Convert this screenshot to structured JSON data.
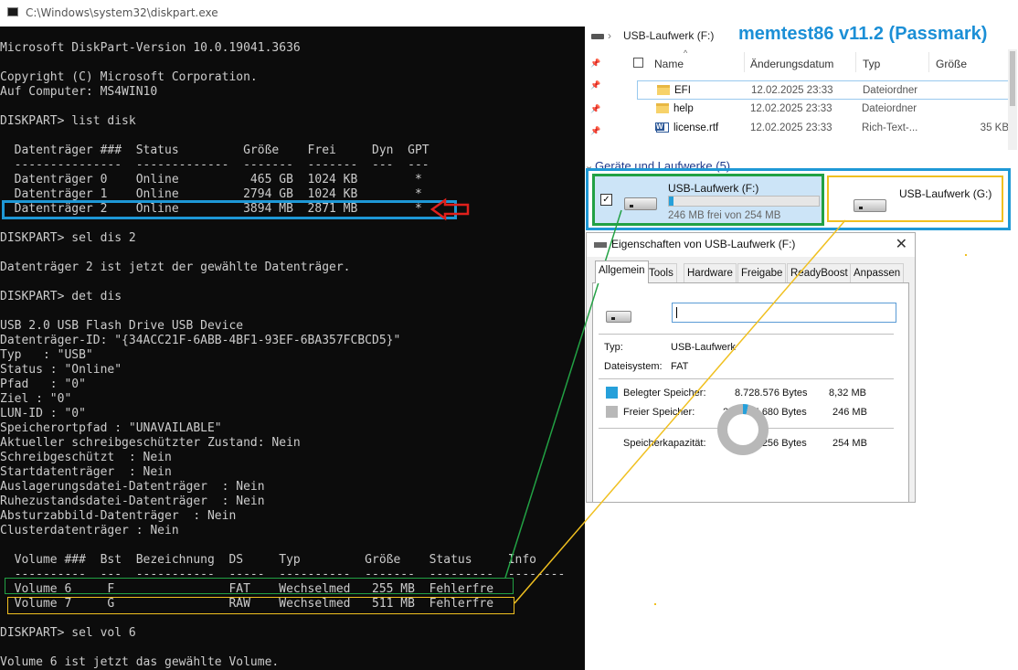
{
  "cmd": {
    "title": "C:\\Windows\\system32\\diskpart.exe",
    "lines": [
      "Microsoft DiskPart-Version 10.0.19041.3636",
      "",
      "Copyright (C) Microsoft Corporation.",
      "Auf Computer: MS4WIN10",
      "",
      "DISKPART> list disk",
      "",
      "  Datenträger ###  Status         Größe    Frei     Dyn  GPT",
      "  ---------------  -------------  -------  -------  ---  ---",
      "  Datenträger 0    Online          465 GB  1024 KB        *",
      "  Datenträger 1    Online         2794 GB  1024 KB        *",
      "  Datenträger 2    Online         3894 MB  2871 MB        *",
      "",
      "DISKPART> sel dis 2",
      "",
      "Datenträger 2 ist jetzt der gewählte Datenträger.",
      "",
      "DISKPART> det dis",
      "",
      "USB 2.0 USB Flash Drive USB Device",
      "Datenträger-ID: \"{34ACC21F-6ABB-4BF1-93EF-6BA357FCBCD5}\"",
      "Typ   : \"USB\"",
      "Status : \"Online\"",
      "Pfad   : \"0\"",
      "Ziel : \"0\"",
      "LUN-ID : \"0\"",
      "Speicherortpfad : \"UNAVAILABLE\"",
      "Aktueller schreibgeschützter Zustand: Nein",
      "Schreibgeschützt  : Nein",
      "Startdatenträger  : Nein",
      "Auslagerungsdatei-Datenträger  : Nein",
      "Ruhezustandsdatei-Datenträger  : Nein",
      "Absturzabbild-Datenträger  : Nein",
      "Clusterdatenträger : Nein",
      "",
      "  Volume ###  Bst  Bezeichnung  DS     Typ         Größe    Status     Info",
      "  ----------  ---  -----------  -----  ----------  -------  ---------  --------",
      "  Volume 6     F                FAT    Wechselmed   255 MB  Fehlerfre",
      "  Volume 7     G                RAW    Wechselmed   511 MB  Fehlerfre",
      "",
      "DISKPART> sel vol 6",
      "",
      "Volume 6 ist jetzt das gewählte Volume."
    ]
  },
  "overlay_title": "memtest86 v11.2 (Passmark)",
  "explorer": {
    "path": "USB-Laufwerk (F:)",
    "columns": [
      "Name",
      "Änderungsdatum",
      "Typ",
      "Größe"
    ],
    "files": [
      {
        "name": "EFI",
        "date": "12.02.2025 23:33",
        "type": "Dateiordner",
        "size": "",
        "icon": "folder-icon"
      },
      {
        "name": "help",
        "date": "12.02.2025 23:33",
        "type": "Dateiordner",
        "size": "",
        "icon": "folder-icon"
      },
      {
        "name": "license.rtf",
        "date": "12.02.2025 23:33",
        "type": "Rich-Text-...",
        "size": "35 KB",
        "icon": "word-document-icon"
      }
    ],
    "devices_header": "Geräte und Laufwerke (5)",
    "drive_f": {
      "name": "USB-Laufwerk (F:)",
      "free_text": "246 MB frei von 254 MB",
      "used_fraction": 0.033
    },
    "drive_g": {
      "name": "USB-Laufwerk (G:)"
    }
  },
  "properties": {
    "title": "Eigenschaften von USB-Laufwerk (F:)",
    "tabs": [
      "Allgemein",
      "Tools",
      "Hardware",
      "Freigabe",
      "ReadyBoost",
      "Anpassen"
    ],
    "active_tab": "Allgemein",
    "type_label": "Typ:",
    "type_value": "USB-Laufwerk",
    "fs_label": "Dateisystem:",
    "fs_value": "FAT",
    "used_label": "Belegter Speicher:",
    "used_bytes": "8.728.576 Bytes",
    "used_mb": "8,32 MB",
    "free_label": "Freier Speicher:",
    "free_bytes": "258.375.680 Bytes",
    "free_mb": "246 MB",
    "cap_label": "Speicherkapazität:",
    "cap_bytes": "267.104.256 Bytes",
    "cap_mb": "254 MB",
    "used_color": "#26a0da",
    "free_color": "#b8b8b8",
    "used_fraction": 0.033
  },
  "colors": {
    "console_bg": "#0c0c0c",
    "console_text": "#cccccc",
    "blue_highlight": "#1e98d6",
    "green_highlight": "#22a144",
    "yellow_highlight": "#f0c020",
    "red_arrow": "#e0201c"
  }
}
